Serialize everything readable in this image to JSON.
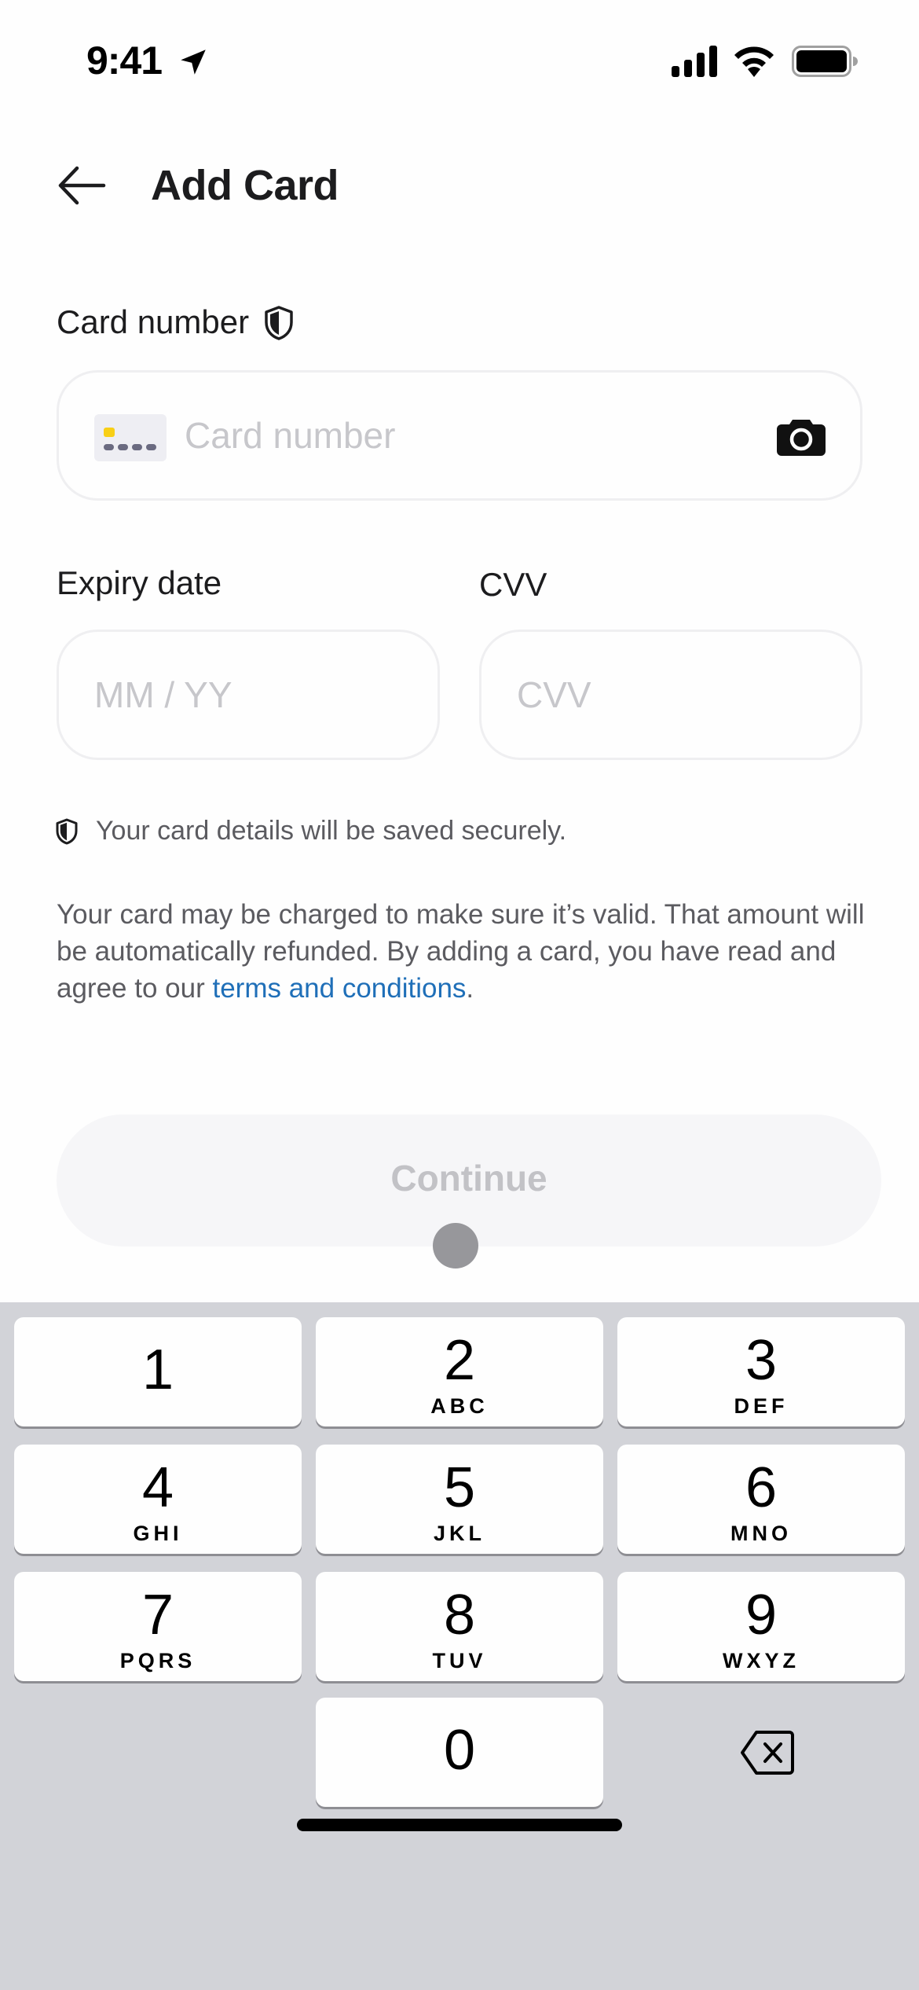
{
  "status_bar": {
    "time": "9:41",
    "icons": [
      "location-arrow-icon",
      "cellular-signal-icon",
      "wifi-icon",
      "battery-icon"
    ]
  },
  "header": {
    "back_icon": "arrow-left-icon",
    "title": "Add Card"
  },
  "form": {
    "card_number": {
      "label": "Card number",
      "label_icon": "shield-icon",
      "value": "",
      "placeholder": "Card number",
      "leading_icon": "credit-card-icon",
      "trailing_icon": "camera-icon"
    },
    "expiry": {
      "label": "Expiry date",
      "value": "",
      "placeholder": "MM / YY"
    },
    "cvv": {
      "label": "CVV",
      "value": "",
      "placeholder": "CVV"
    }
  },
  "secure_note": {
    "icon": "shield-icon",
    "text": "Your card details will be saved securely."
  },
  "legal": {
    "text_before_link": "Your card may be charged to make sure it’s valid. That amount will be automatically refunded. By adding a card, you have read and agree to our ",
    "link_text": "terms and conditions",
    "text_after_link": "."
  },
  "continue_button": {
    "label": "Continue",
    "enabled": false
  },
  "keyboard": {
    "keys": [
      {
        "digit": "1",
        "letters": ""
      },
      {
        "digit": "2",
        "letters": "ABC"
      },
      {
        "digit": "3",
        "letters": "DEF"
      },
      {
        "digit": "4",
        "letters": "GHI"
      },
      {
        "digit": "5",
        "letters": "JKL"
      },
      {
        "digit": "6",
        "letters": "MNO"
      },
      {
        "digit": "7",
        "letters": "PQRS"
      },
      {
        "digit": "8",
        "letters": "TUV"
      },
      {
        "digit": "9",
        "letters": "WXYZ"
      },
      {
        "digit": "0",
        "letters": ""
      }
    ],
    "delete_icon": "backspace-icon"
  },
  "colors": {
    "link": "#1f6fb8",
    "card_chip": "#f8cf16",
    "button_disabled_bg": "#f6f6f8",
    "button_disabled_text": "#c2c2c6",
    "keyboard_bg": "#d2d3d8"
  }
}
